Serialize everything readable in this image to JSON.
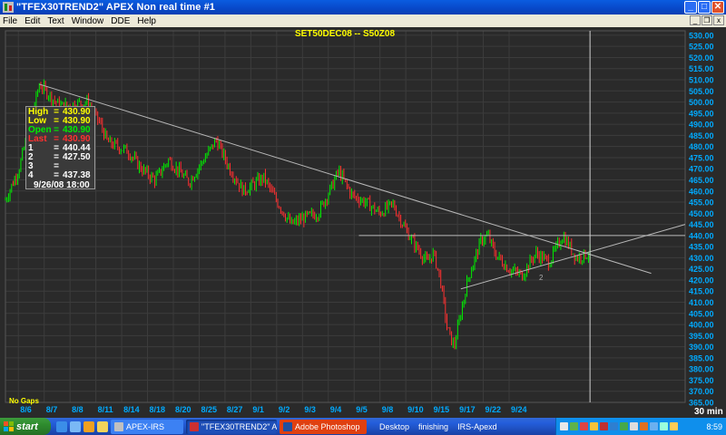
{
  "window": {
    "title": "\"TFEX30TREND2\" APEX Non real time #1",
    "controls": {
      "minimize": "_",
      "maximize": "□",
      "close": "✕"
    }
  },
  "menu": {
    "items": [
      "File",
      "Edit",
      "Text",
      "Window",
      "DDE",
      "Help"
    ],
    "mdi_controls": {
      "minimize": "_",
      "restore": "❐",
      "close": "x"
    }
  },
  "colors": {
    "background": "#000000",
    "grid": "#3c3c3c",
    "up_bar": "#00ee00",
    "down_bar": "#ff3030",
    "trendline": "#b8b8b8",
    "axis_text": "#00aaff",
    "title_text": "#ffff00"
  },
  "chart_data": {
    "type": "line",
    "title": "SET50DEC08 -- S50Z08",
    "ylim": [
      365,
      532
    ],
    "y_ticks": [
      "530.00",
      "525.00",
      "520.00",
      "515.00",
      "510.00",
      "505.00",
      "500.00",
      "495.00",
      "490.00",
      "485.00",
      "480.00",
      "475.00",
      "470.00",
      "465.00",
      "460.00",
      "455.00",
      "450.00",
      "445.00",
      "440.00",
      "435.00",
      "430.00",
      "425.00",
      "420.00",
      "415.00",
      "410.00",
      "405.00",
      "400.00",
      "395.00",
      "390.00",
      "385.00",
      "380.00",
      "375.00",
      "370.00",
      "365.00"
    ],
    "x_labels": [
      "8/6",
      "8/7",
      "8/8",
      "8/11",
      "8/14",
      "8/18",
      "8/20",
      "8/25",
      "8/27",
      "9/1",
      "9/2",
      "9/3",
      "9/4",
      "9/5",
      "9/8",
      "9/10",
      "9/15",
      "9/17",
      "9/22",
      "9/24"
    ],
    "timeframe": "30 min",
    "bottom_note": "No Gaps",
    "cursor_label": "2",
    "price_path": [
      {
        "x": 0,
        "y": 456
      },
      {
        "x": 2,
        "y": 470
      },
      {
        "x": 4,
        "y": 495
      },
      {
        "x": 5,
        "y": 508
      },
      {
        "x": 8,
        "y": 498
      },
      {
        "x": 12,
        "y": 500
      },
      {
        "x": 14,
        "y": 490
      },
      {
        "x": 15,
        "y": 482
      },
      {
        "x": 18,
        "y": 478
      },
      {
        "x": 20,
        "y": 470
      },
      {
        "x": 22,
        "y": 465
      },
      {
        "x": 24,
        "y": 474
      },
      {
        "x": 27,
        "y": 464
      },
      {
        "x": 30,
        "y": 478
      },
      {
        "x": 31,
        "y": 483
      },
      {
        "x": 33,
        "y": 470
      },
      {
        "x": 35,
        "y": 460
      },
      {
        "x": 38,
        "y": 466
      },
      {
        "x": 40,
        "y": 455
      },
      {
        "x": 42,
        "y": 445
      },
      {
        "x": 44,
        "y": 448
      },
      {
        "x": 46,
        "y": 450
      },
      {
        "x": 48,
        "y": 462
      },
      {
        "x": 49,
        "y": 469
      },
      {
        "x": 51,
        "y": 458
      },
      {
        "x": 53,
        "y": 455
      },
      {
        "x": 55,
        "y": 450
      },
      {
        "x": 57,
        "y": 454
      },
      {
        "x": 59,
        "y": 442
      },
      {
        "x": 60,
        "y": 437
      },
      {
        "x": 62,
        "y": 428
      },
      {
        "x": 63,
        "y": 432
      },
      {
        "x": 64,
        "y": 420
      },
      {
        "x": 65,
        "y": 398
      },
      {
        "x": 66,
        "y": 390
      },
      {
        "x": 68,
        "y": 420
      },
      {
        "x": 70,
        "y": 438
      },
      {
        "x": 71,
        "y": 440
      },
      {
        "x": 72,
        "y": 432
      },
      {
        "x": 74,
        "y": 425
      },
      {
        "x": 76,
        "y": 422
      },
      {
        "x": 78,
        "y": 432
      },
      {
        "x": 80,
        "y": 428
      },
      {
        "x": 82,
        "y": 440
      },
      {
        "x": 84,
        "y": 430
      },
      {
        "x": 86,
        "y": 432
      }
    ],
    "trendlines": [
      {
        "name": "resistance",
        "start": {
          "x": 5,
          "y": 508
        },
        "end": {
          "x": 95,
          "y": 423
        }
      },
      {
        "name": "support",
        "start": {
          "x": 67,
          "y": 416
        },
        "end": {
          "x": 100,
          "y": 445
        }
      },
      {
        "name": "horizontal",
        "start": {
          "x": 52,
          "y": 440
        },
        "end": {
          "x": 100,
          "y": 440
        }
      }
    ],
    "cursor_x": 86
  },
  "info_box": {
    "rows": [
      {
        "key": "High",
        "value": "430.90",
        "color": "#ffff00"
      },
      {
        "key": "Low",
        "value": "430.90",
        "color": "#ffff00"
      },
      {
        "key": "Open",
        "value": "430.90",
        "color": "#00ee00"
      },
      {
        "key": "Last",
        "value": "430.90",
        "color": "#ff3030"
      },
      {
        "key": "1",
        "value": "440.44",
        "color": "#ffffff"
      },
      {
        "key": "2",
        "value": "427.50",
        "color": "#ffffff"
      },
      {
        "key": "3",
        "value": "",
        "color": "#ffffff"
      },
      {
        "key": "4",
        "value": "437.38",
        "color": "#ffffff"
      }
    ],
    "eq": "=",
    "date": "9/26/08   18:00"
  },
  "taskbar": {
    "start_label": "start",
    "buttons": [
      {
        "label": "APEX-IRS",
        "style": "normal"
      },
      {
        "label": "\"TFEX30TREND2\" AP...",
        "style": "active"
      },
      {
        "label": "Adobe Photoshop",
        "style": "ps"
      }
    ],
    "desktop_items": [
      "Desktop",
      "finishing",
      "IRS-Apexd"
    ],
    "clock": "8:59"
  }
}
